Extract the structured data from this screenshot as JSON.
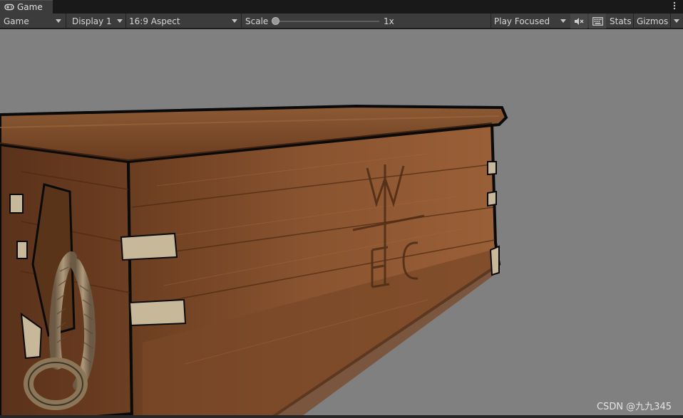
{
  "tab": {
    "label": "Game",
    "icon": "gamepad-icon"
  },
  "window_menu_icon": "kebab-menu-icon",
  "toolbar": {
    "view_mode": "Game",
    "display": "Display 1",
    "aspect": "16:9 Aspect",
    "scale_label": "Scale",
    "scale_value": "1x",
    "scale_slider_level": 0.0,
    "play_mode": "Play Focused",
    "mute_icon": "mute-audio-icon",
    "stats_icon": "stats-keyboard-icon",
    "stats_label": "Stats",
    "gizmos_label": "Gizmos"
  },
  "viewport": {
    "background_color": "#808080",
    "object": "wooden-chest",
    "chest_lettering": [
      "W",
      "E",
      "C"
    ]
  },
  "watermark": "CSDN @九九345"
}
